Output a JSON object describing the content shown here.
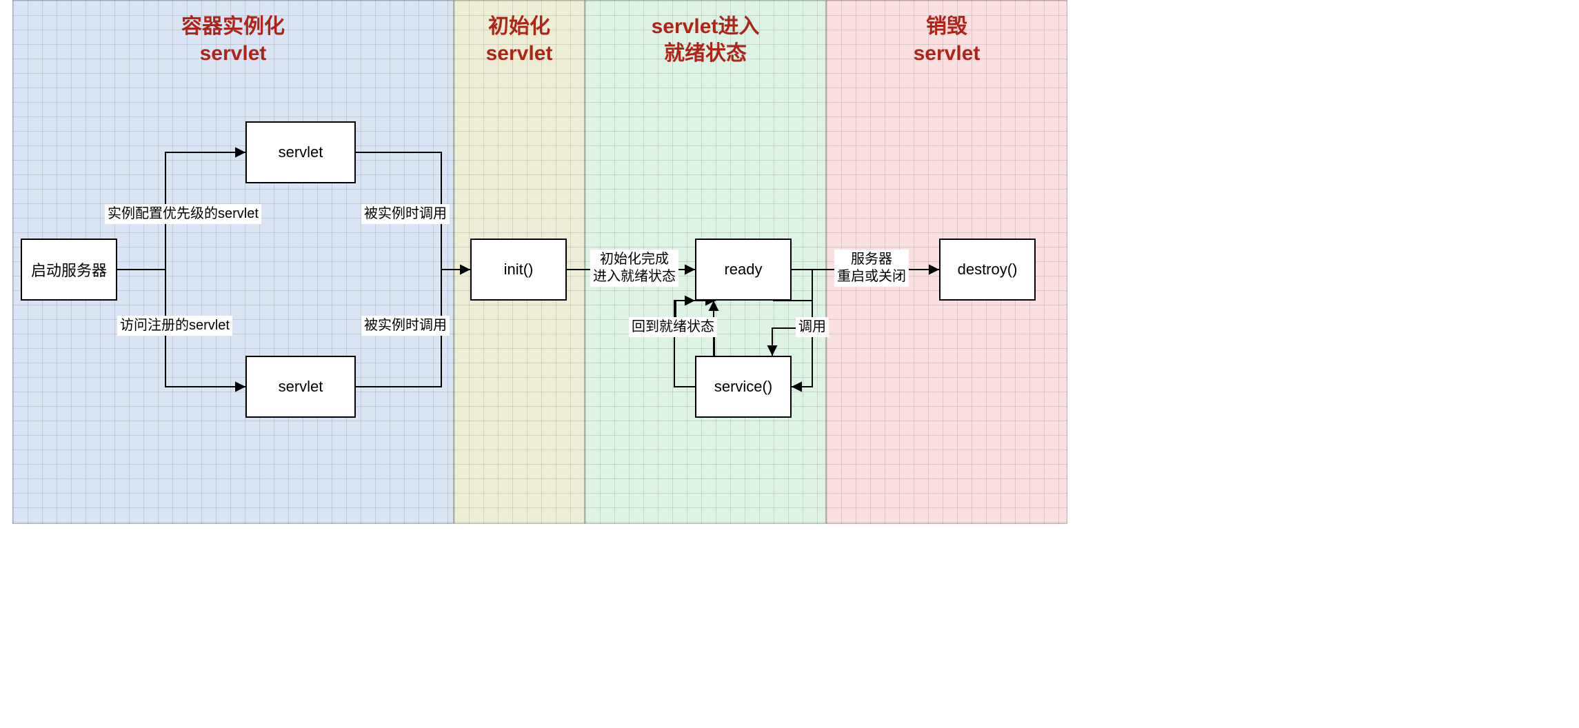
{
  "phases": {
    "instantiate": {
      "title_l1": "容器实例化",
      "title_l2": "servlet"
    },
    "init": {
      "title_l1": "初始化",
      "title_l2": "servlet"
    },
    "ready": {
      "title_l1": "servlet进入",
      "title_l2": "就绪状态"
    },
    "destroy": {
      "title_l1": "销毁",
      "title_l2": "servlet"
    }
  },
  "nodes": {
    "start": "启动服务器",
    "servlet_top": "servlet",
    "servlet_bot": "servlet",
    "init": "init()",
    "ready": "ready",
    "service": "service()",
    "destroy": "destroy()"
  },
  "edges": {
    "cfg_priority": "实例配置优先级的servlet",
    "visit_reg": "访问注册的servlet",
    "on_inst_top": "被实例时调用",
    "on_inst_bot": "被实例时调用",
    "init_done": "初始化完成\n进入就绪状态",
    "back_ready": "回到就绪状态",
    "call": "调用",
    "restart": "服务器\n重启或关闭"
  }
}
